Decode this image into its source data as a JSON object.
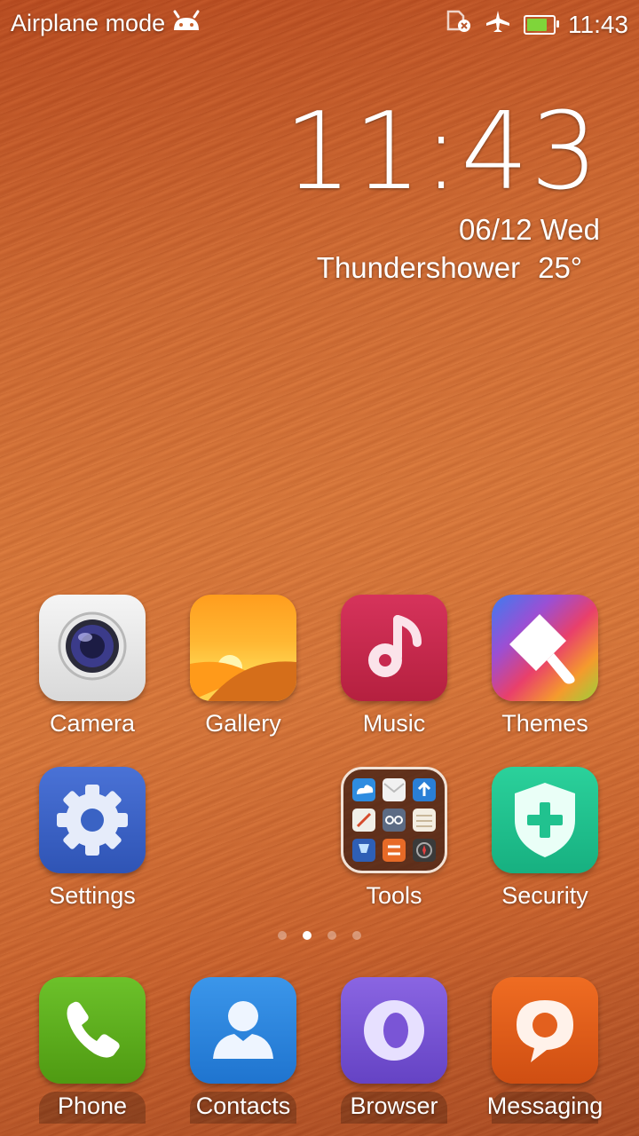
{
  "status_bar": {
    "mode_text": "Airplane mode",
    "time": "11:43",
    "battery_level": 0.8,
    "icons": [
      "android-icon",
      "sim-error-icon",
      "airplane-icon",
      "battery-icon"
    ]
  },
  "clock_widget": {
    "time": "11:43",
    "date": "06/12 Wed",
    "weather": "Thundershower",
    "temperature": "25°"
  },
  "apps": [
    {
      "label": "Camera",
      "icon": "camera-icon"
    },
    {
      "label": "Gallery",
      "icon": "gallery-icon"
    },
    {
      "label": "Music",
      "icon": "music-icon"
    },
    {
      "label": "Themes",
      "icon": "themes-icon"
    },
    {
      "label": "Settings",
      "icon": "settings-icon"
    },
    {
      "label": "Tools",
      "icon": "tools-folder-icon"
    },
    {
      "label": "Security",
      "icon": "security-icon"
    }
  ],
  "pager": {
    "pages": 4,
    "active": 2
  },
  "dock": [
    {
      "label": "Phone",
      "icon": "phone-icon"
    },
    {
      "label": "Contacts",
      "icon": "contacts-icon"
    },
    {
      "label": "Browser",
      "icon": "browser-icon"
    },
    {
      "label": "Messaging",
      "icon": "messaging-icon"
    }
  ],
  "colors": {
    "wallpaper": "#cf6a32",
    "music": "#c7294f",
    "settings": "#3a63c4",
    "security": "#21c28f",
    "phone": "#5dae1b",
    "contacts": "#2c86e0",
    "browser": "#7a55d6",
    "messaging": "#e3601e"
  }
}
